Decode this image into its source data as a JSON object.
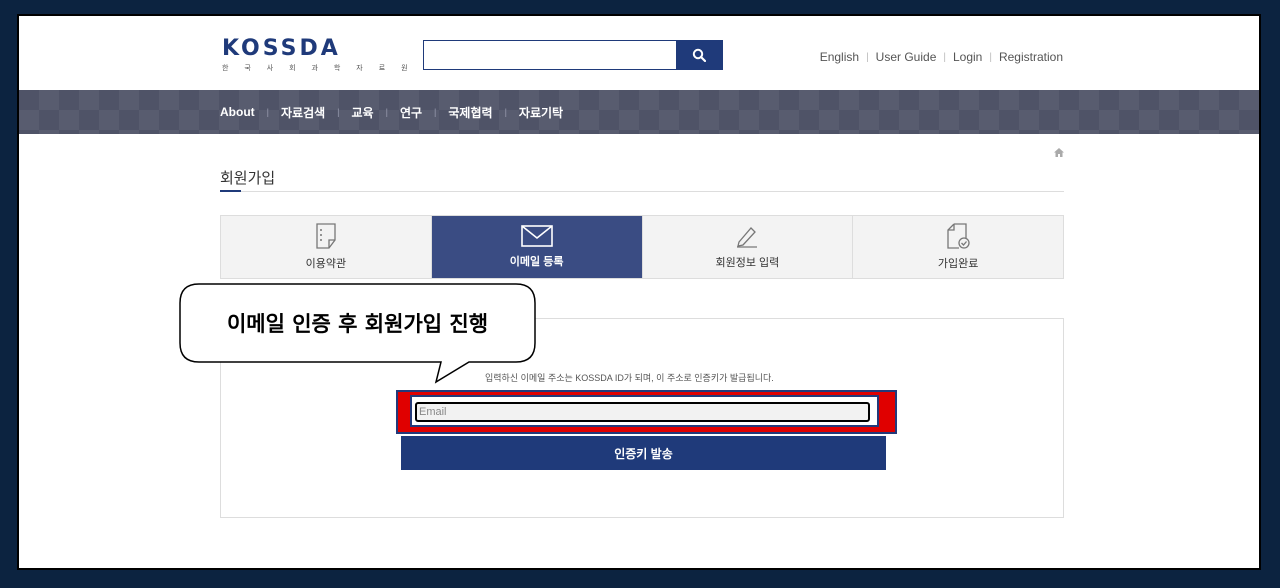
{
  "header": {
    "logo_text": "KOSSDA",
    "logo_subtitle": "한 국 사 회 과 학 자 료 원",
    "search_placeholder": "",
    "links": [
      "English",
      "User Guide",
      "Login",
      "Registration"
    ]
  },
  "nav": {
    "items": [
      "About",
      "자료검색",
      "교육",
      "연구",
      "국제협력",
      "자료기탁"
    ]
  },
  "page": {
    "title": "회원가입"
  },
  "steps": [
    {
      "label": "이용약관",
      "icon": "document-list-icon",
      "active": false
    },
    {
      "label": "이메일 등록",
      "icon": "envelope-icon",
      "active": true
    },
    {
      "label": "회원정보 입력",
      "icon": "pencil-icon",
      "active": false
    },
    {
      "label": "가입완료",
      "icon": "document-check-icon",
      "active": false
    }
  ],
  "form": {
    "hint": "입력하신 이메일 주소는 KOSSDA ID가 되며, 이 주소로 인증키가 발급됩니다.",
    "email_placeholder": "Email",
    "send_button": "인증키 발송"
  },
  "callout": {
    "text": "이메일 인증 후 회원가입 진행"
  },
  "colors": {
    "brand": "#1f3a7a",
    "active_step": "#3a4c83",
    "nav_bg": "#4f5367",
    "highlight": "#e00000",
    "outer_bg": "#0c2340"
  }
}
